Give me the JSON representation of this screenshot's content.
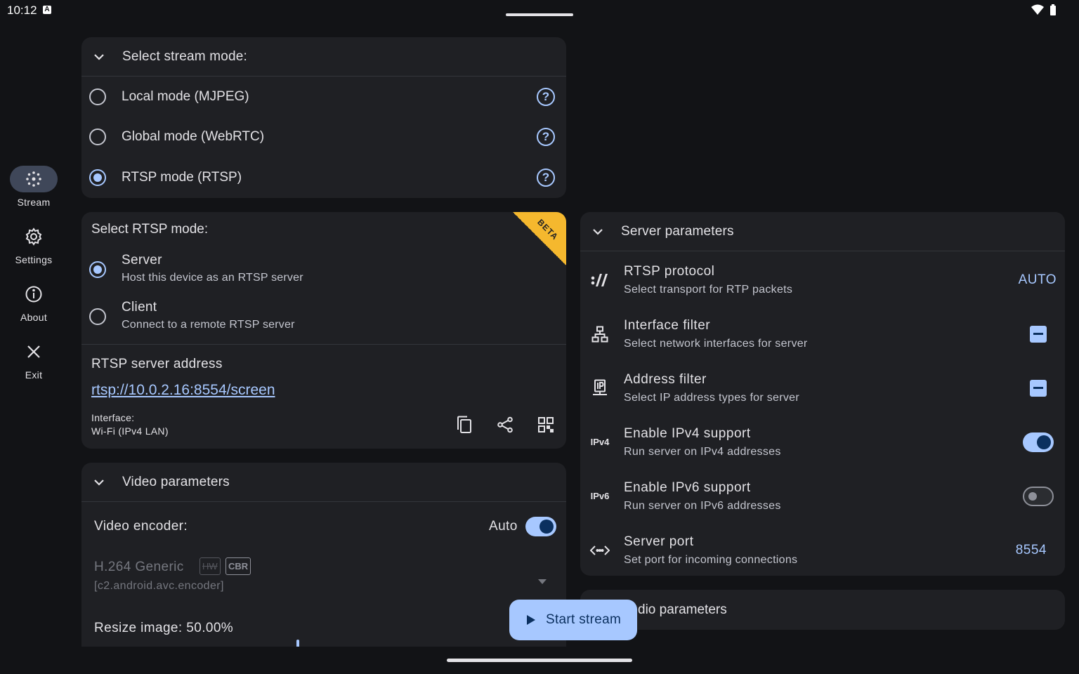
{
  "status": {
    "time": "10:12",
    "indicator": "A"
  },
  "rail": [
    {
      "label": "Stream",
      "icon": "stream-icon",
      "active": true
    },
    {
      "label": "Settings",
      "icon": "gear-icon",
      "active": false
    },
    {
      "label": "About",
      "icon": "info-icon",
      "active": false
    },
    {
      "label": "Exit",
      "icon": "close-icon",
      "active": false
    }
  ],
  "stream_mode": {
    "title": "Select stream mode:",
    "options": [
      {
        "label": "Local mode (MJPEG)",
        "selected": false
      },
      {
        "label": "Global mode (WebRTC)",
        "selected": false
      },
      {
        "label": "RTSP mode (RTSP)",
        "selected": true
      }
    ],
    "help_glyph": "?"
  },
  "rtsp_mode": {
    "title": "Select RTSP mode:",
    "beta": "BETA",
    "options": [
      {
        "title": "Server",
        "subtitle": "Host this device as an RTSP server",
        "selected": true
      },
      {
        "title": "Client",
        "subtitle": "Connect to a remote RTSP server",
        "selected": false
      }
    ],
    "address_label": "RTSP server address",
    "address": "rtsp://10.0.2.16:8554/screen",
    "interface_label": "Interface:",
    "interface_value": "Wi-Fi (IPv4 LAN)"
  },
  "video": {
    "title": "Video parameters",
    "encoder_label": "Video encoder:",
    "auto_label": "Auto",
    "auto_on": true,
    "encoder_name": "H.264 Generic",
    "badge_hw": "HW",
    "badge_cbr": "CBR",
    "encoder_id": "[c2.android.avc.encoder]",
    "resize_label": "Resize image: 50.00%"
  },
  "server": {
    "title": "Server parameters",
    "rows": [
      {
        "title": "RTSP protocol",
        "subtitle": "Select transport for RTP packets",
        "value": "AUTO",
        "icon": "protocol-icon"
      },
      {
        "title": "Interface filter",
        "subtitle": "Select network interfaces for server",
        "icon": "network-icon"
      },
      {
        "title": "Address filter",
        "subtitle": "Select IP address types for server",
        "icon": "ip-address-icon"
      },
      {
        "title": "Enable IPv4 support",
        "subtitle": "Run server on IPv4 addresses",
        "icon_text": "IPv4",
        "switch_on": true
      },
      {
        "title": "Enable IPv6 support",
        "subtitle": "Run server on IPv6 addresses",
        "icon_text": "IPv6",
        "switch_on": false
      },
      {
        "title": "Server port",
        "subtitle": "Set port for incoming connections",
        "value": "8554",
        "icon": "code-icon"
      }
    ]
  },
  "audio": {
    "title": "Audio parameters",
    "visible_title": "dio parameters"
  },
  "fab": {
    "label": "Start stream"
  },
  "colors": {
    "accent": "#a7c8ff",
    "surface": "#1f2024",
    "background": "#121316",
    "beta": "#f5b82e"
  }
}
